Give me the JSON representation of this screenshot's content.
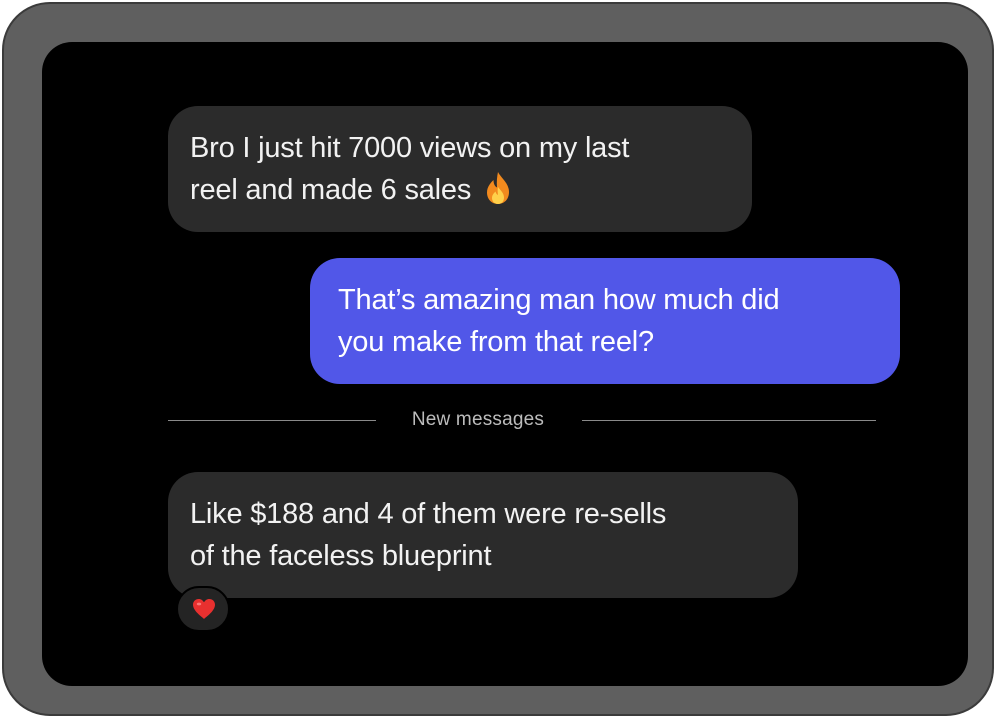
{
  "conversation": {
    "messages": [
      {
        "direction": "received",
        "lines": [
          "Bro I just hit 7000 views on my last",
          "reel and made 6 sales"
        ],
        "emoji": "fire-icon"
      },
      {
        "direction": "sent",
        "lines": [
          "That’s amazing man how much did",
          "you make from that reel?"
        ]
      },
      {
        "direction": "received",
        "lines": [
          "Like $188 and 4 of them were re-sells",
          "of the faceless blueprint"
        ],
        "reaction": "heart-icon"
      }
    ],
    "divider_label": "New messages"
  },
  "colors": {
    "frame": "#5f5f5f",
    "screen": "#000000",
    "received_bubble": "#2b2b2b",
    "sent_bubble": "#5157e8",
    "text": "#f2f2f2",
    "divider": "#8a8a8a"
  }
}
